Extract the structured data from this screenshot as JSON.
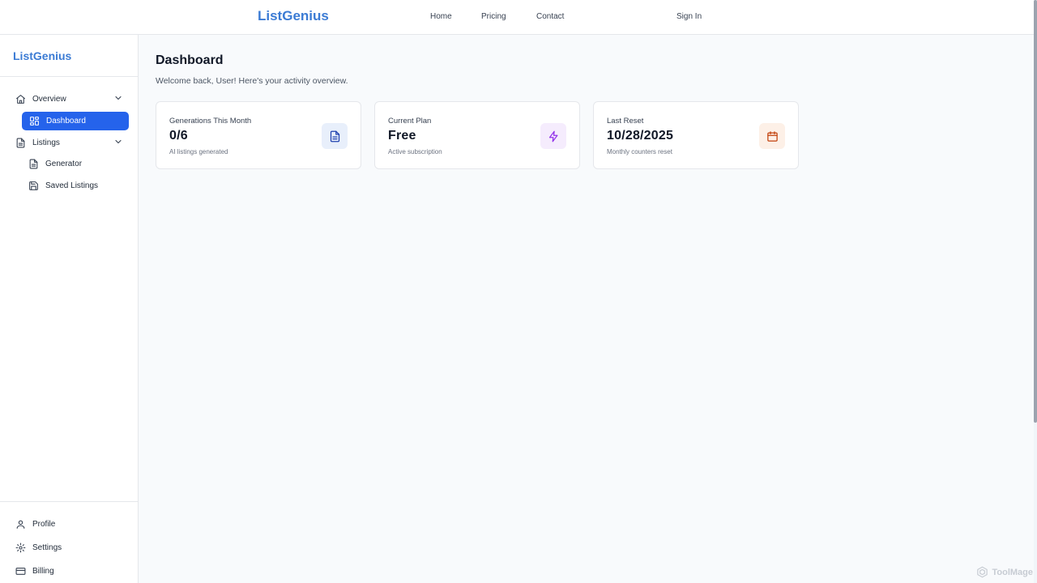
{
  "topnav": {
    "brand": "ListGenius",
    "links": [
      "Home",
      "Pricing",
      "Contact"
    ],
    "sign_in": "Sign In"
  },
  "sidebar": {
    "brand": "ListGenius",
    "sections": [
      {
        "label": "Overview",
        "icon": "home-icon"
      },
      {
        "label": "Listings",
        "icon": "document-icon"
      }
    ],
    "items": {
      "dashboard": "Dashboard",
      "generator": "Generator",
      "saved_listings": "Saved Listings"
    },
    "bottom": {
      "profile": "Profile",
      "settings": "Settings",
      "billing": "Billing"
    }
  },
  "main": {
    "title": "Dashboard",
    "subtitle": "Welcome back, User! Here's your activity overview."
  },
  "cards": [
    {
      "label": "Generations This Month",
      "value": "0/6",
      "caption": "AI listings generated",
      "icon": "document-icon",
      "accent": "#1e40af",
      "tint": "#e8effb"
    },
    {
      "label": "Current Plan",
      "value": "Free",
      "caption": "Active subscription",
      "icon": "lightning-icon",
      "accent": "#9333ea",
      "tint": "#f5ecfd"
    },
    {
      "label": "Last Reset",
      "value": "10/28/2025",
      "caption": "Monthly counters reset",
      "icon": "calendar-icon",
      "accent": "#c2410c",
      "tint": "#fdf0e7"
    }
  ],
  "watermark": "ToolMage",
  "colors": {
    "brand": "#3b7bd4",
    "active": "#2563eb"
  }
}
